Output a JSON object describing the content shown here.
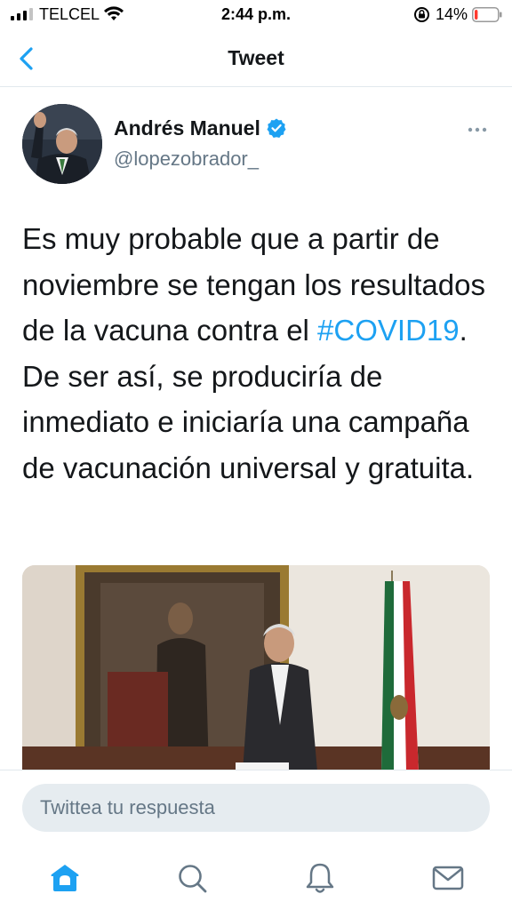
{
  "status_bar": {
    "carrier": "TELCEL",
    "time": "2:44 p.m.",
    "battery_percent": "14%",
    "battery_level": 0.14,
    "icons": [
      "signal-icon",
      "wifi-icon",
      "rotation-lock-icon",
      "battery-icon"
    ]
  },
  "nav": {
    "title": "Tweet",
    "back_icon": "chevron-left-icon"
  },
  "tweet": {
    "author_name": "Andrés Manuel",
    "verified_icon": "verified-badge-icon",
    "handle": "@lopezobrador_",
    "more_icon": "more-horizontal-icon",
    "text_before": "Es muy probable que a partir de noviembre se tengan los resultados de la vacuna contra el ",
    "hashtag": "#COVID19",
    "text_after": ". De ser así, se produciría de inmediato e iniciaría una campaña de vacunación universal y gratuita."
  },
  "reply": {
    "placeholder": "Twittea tu respuesta"
  },
  "tabbar": {
    "items": [
      "home-icon",
      "search-icon",
      "notifications-icon",
      "messages-icon"
    ]
  },
  "colors": {
    "accent": "#1da1f2",
    "text": "#14171a",
    "secondary": "#657786",
    "input_bg": "#e6ecf0",
    "battery_low": "#ff3b30"
  }
}
